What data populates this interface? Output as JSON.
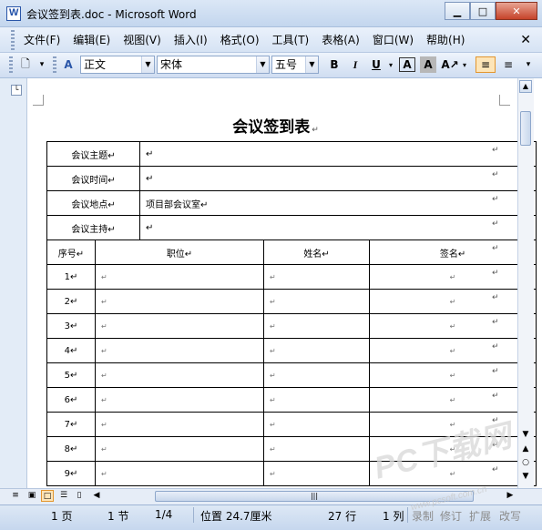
{
  "window": {
    "title": "会议签到表.doc - Microsoft Word"
  },
  "menu": [
    "文件(F)",
    "编辑(E)",
    "视图(V)",
    "插入(I)",
    "格式(O)",
    "工具(T)",
    "表格(A)",
    "窗口(W)",
    "帮助(H)"
  ],
  "toolbar": {
    "style_value": "正文",
    "font_value": "宋体",
    "size_value": "五号"
  },
  "document": {
    "title": "会议签到表",
    "para_mark": "↵",
    "info_rows": [
      {
        "label": "会议主题",
        "value": ""
      },
      {
        "label": "会议时间",
        "value": ""
      },
      {
        "label": "会议地点",
        "value": "项目部会议室"
      },
      {
        "label": "会议主持",
        "value": ""
      }
    ],
    "headers": [
      "序号",
      "职位",
      "姓名",
      "签名"
    ],
    "row_numbers": [
      "1",
      "2",
      "3",
      "4",
      "5",
      "6",
      "7",
      "8",
      "9"
    ]
  },
  "status": {
    "page": "1 页",
    "section": "1 节",
    "page_of": "1/4",
    "position": "位置 24.7厘米",
    "line": "27 行",
    "column": "1 列",
    "rec": "录制",
    "trk": "修订",
    "ext": "扩展",
    "ovr": "改写"
  },
  "watermark": {
    "logo": "PC下载网",
    "url": "www.pcsoft.com.cn"
  }
}
